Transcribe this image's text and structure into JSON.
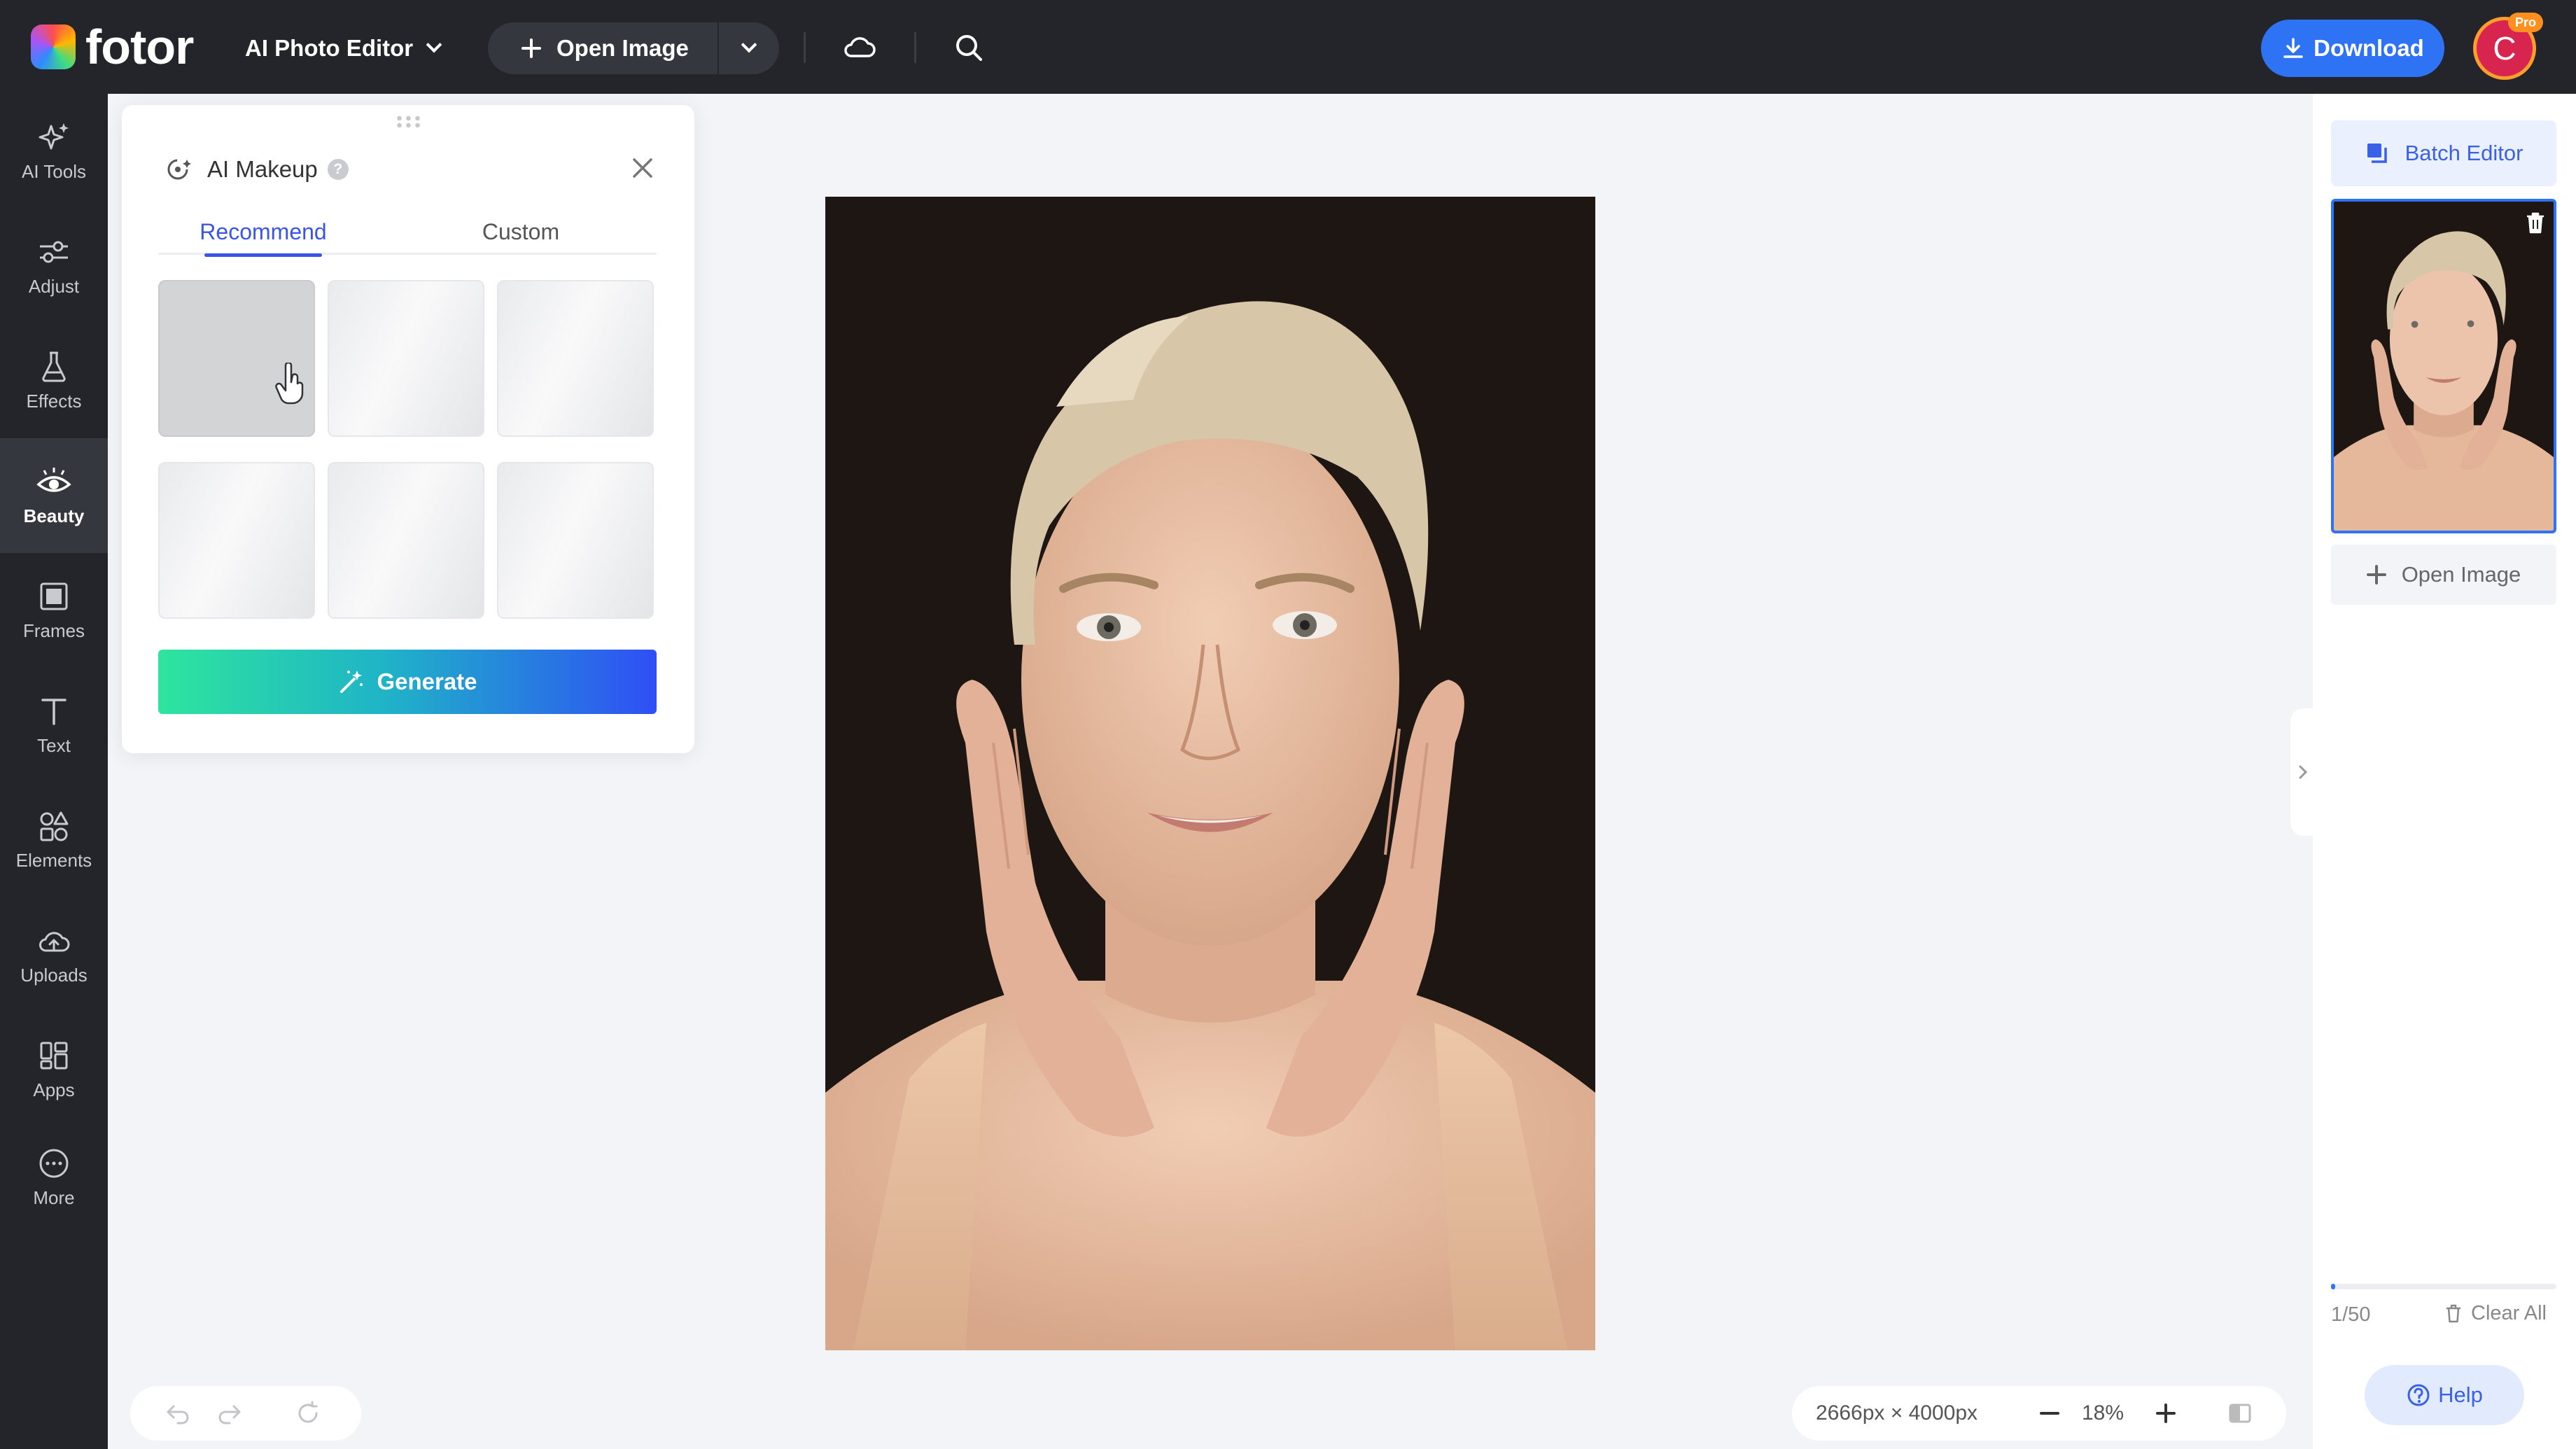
{
  "app": {
    "logo_text": "fotor",
    "editor_menu_label": "AI Photo Editor",
    "open_image_label": "Open Image",
    "download_label": "Download",
    "avatar_initial": "C",
    "pro_badge": "Pro"
  },
  "sidebar": {
    "items": [
      {
        "label": "AI Tools",
        "icon": "sparkle-icon"
      },
      {
        "label": "Adjust",
        "icon": "sliders-icon"
      },
      {
        "label": "Effects",
        "icon": "flask-icon"
      },
      {
        "label": "Beauty",
        "icon": "eye-icon",
        "active": true
      },
      {
        "label": "Frames",
        "icon": "frame-icon"
      },
      {
        "label": "Text",
        "icon": "text-icon"
      },
      {
        "label": "Elements",
        "icon": "shapes-icon"
      },
      {
        "label": "Uploads",
        "icon": "cloud-upload-icon"
      },
      {
        "label": "Apps",
        "icon": "apps-icon"
      },
      {
        "label": "More",
        "icon": "more-icon"
      }
    ]
  },
  "panel": {
    "title": "AI Makeup",
    "help_glyph": "?",
    "tabs": [
      {
        "label": "Recommend",
        "active": true
      },
      {
        "label": "Custom",
        "active": false
      }
    ],
    "presets_count": 6,
    "generate_label": "Generate"
  },
  "right_panel": {
    "batch_editor_label": "Batch Editor",
    "open_image_label": "Open Image",
    "count_text": "1/50",
    "progress": 0.02,
    "clear_all_label": "Clear All",
    "help_label": "Help"
  },
  "canvas": {
    "dimensions_text": "2666px × 4000px",
    "zoom_text": "18%"
  },
  "colors": {
    "accent": "#2f73f5",
    "tab_active": "#3a55e8",
    "topbar_bg": "#23252b",
    "generate_gradient_start": "#2ee59d",
    "generate_gradient_end": "#2f4ff5"
  }
}
